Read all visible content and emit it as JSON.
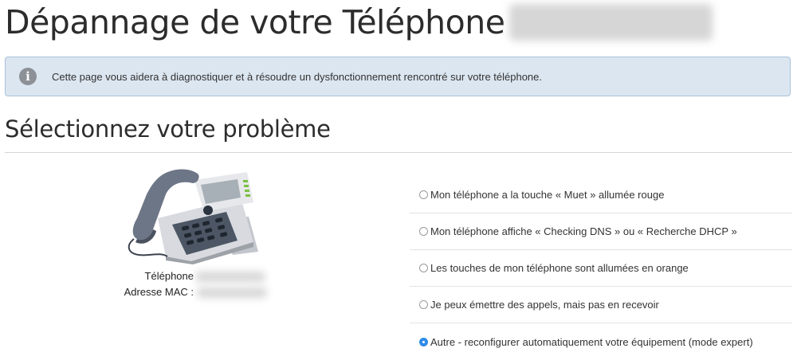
{
  "header": {
    "title": "Dépannage de votre Téléphone",
    "title_suffix_redacted": true
  },
  "info": {
    "icon": "info-icon",
    "text": "Cette page vous aidera à diagnostiquer et à résoudre un dysfonctionnement rencontré sur votre téléphone."
  },
  "section": {
    "title": "Sélectionnez votre problème"
  },
  "device": {
    "image": "ip-desk-phone",
    "phone_label": "Téléphone",
    "mac_label": "Adresse MAC :"
  },
  "options": [
    {
      "label": "Mon téléphone a la touche « Muet » allumée rouge",
      "selected": false
    },
    {
      "label": "Mon téléphone affiche « Checking DNS » ou « Recherche DHCP »",
      "selected": false
    },
    {
      "label": "Les touches de mon téléphone sont allumées en orange",
      "selected": false
    },
    {
      "label": "Je peux émettre des appels, mais pas en recevoir",
      "selected": false
    },
    {
      "label": "Autre - reconfigurer automatiquement votre équipement (mode expert)",
      "selected": true
    }
  ],
  "colors": {
    "accent": "#2f8ce8",
    "info_bg": "#dce6f0",
    "info_border": "#a9c1d9"
  }
}
